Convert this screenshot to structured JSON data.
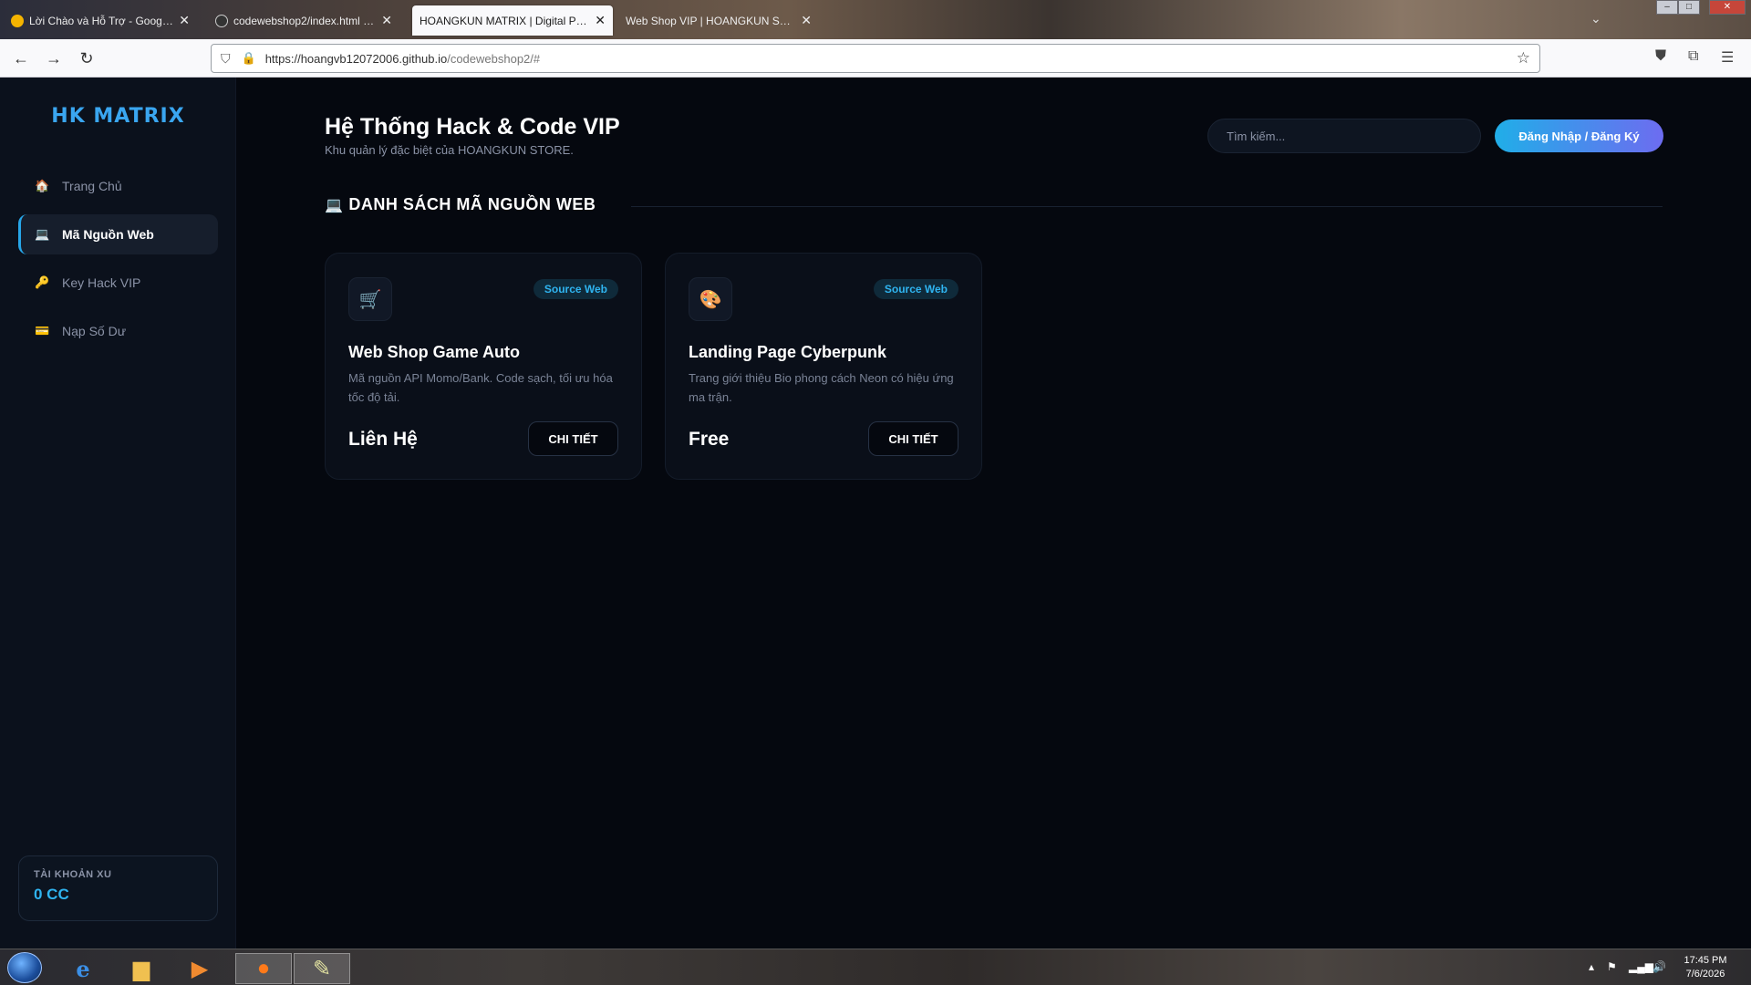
{
  "browser": {
    "tabs": [
      {
        "title": "Lời Chào và Hỗ Trợ - Google G",
        "favicon_color": "#f4b400"
      },
      {
        "title": "codewebshop2/index.html at m",
        "favicon_color": "#333333"
      },
      {
        "title": "HOANGKUN MATRIX | Digital Produ",
        "favicon_color": "#ffffff"
      },
      {
        "title": "Web Shop VIP | HOANGKUN STORE",
        "favicon_color": "#ffffff"
      }
    ],
    "url_host": "https://hoangvb12072006.github.io",
    "url_path": "/codewebshop2/#"
  },
  "sidebar": {
    "brand": "HK MATRIX",
    "items": [
      {
        "icon": "🏠",
        "label": "Trang Chủ"
      },
      {
        "icon": "💻",
        "label": "Mã Nguồn Web"
      },
      {
        "icon": "🔑",
        "label": "Key Hack VIP"
      },
      {
        "icon": "💳",
        "label": "Nạp Số Dư"
      }
    ],
    "active_item": "Mã Nguồn Web",
    "wallet_label": "TÀI KHOẢN XU",
    "wallet_value": "0 CC"
  },
  "header": {
    "title": "Hệ Thống Hack & Code VIP",
    "subtitle": "Khu quản lý đặc biệt của HOANGKUN STORE.",
    "search_placeholder": "Tìm kiếm...",
    "login_label": "Đăng Nhập / Đăng Ký"
  },
  "section": {
    "icon": "💻",
    "title": "DANH SÁCH MÃ NGUỒN WEB"
  },
  "products": [
    {
      "icon": "🛒",
      "badge": "Source Web",
      "title": "Web Shop Game Auto",
      "desc": "Mã nguồn API Momo/Bank. Code sạch, tối ưu hóa tốc độ tải.",
      "price": "Liên Hệ",
      "button": "CHI TIẾT"
    },
    {
      "icon": "🎨",
      "badge": "Source Web",
      "title": "Landing Page Cyberpunk",
      "desc": "Trang giới thiệu Bio phong cách Neon có hiệu ứng ma trận.",
      "price": "Free",
      "button": "CHI TIẾT"
    }
  ],
  "taskbar": {
    "time": "17:45 PM",
    "date": "7/6/2026"
  },
  "colors": {
    "accent": "#2fb4f0",
    "background": "#05080f",
    "sidebar": "#0b111c"
  }
}
